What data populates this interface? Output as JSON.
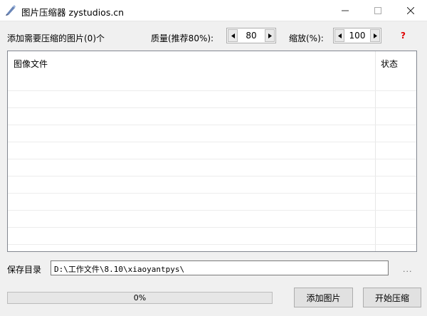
{
  "window": {
    "title": "图片压缩器 zystudios.cn"
  },
  "toolbar": {
    "add_label": "添加需要压缩的图片(0)个",
    "quality_label": "质量(推荐80%):",
    "quality_value": "80",
    "scale_label": "缩放(%):",
    "scale_value": "100",
    "help_label": "?"
  },
  "list": {
    "columns": [
      "图像文件",
      "状态"
    ],
    "rows": []
  },
  "save": {
    "label": "保存目录",
    "path": "D:\\工作文件\\8.10\\xiaoyantpys\\",
    "browse_label": "..."
  },
  "progress": {
    "value": 0,
    "text": "0%"
  },
  "buttons": {
    "add_label": "添加图片",
    "start_label": "开始压缩"
  },
  "colors": {
    "help_mark": "#e00000",
    "window_bg": "#f0f0f0"
  }
}
